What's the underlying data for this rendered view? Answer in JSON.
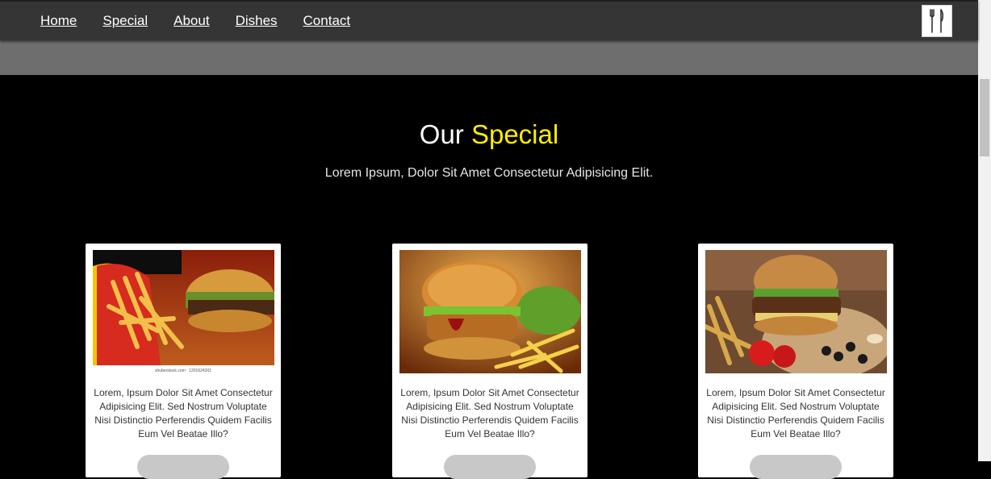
{
  "nav": {
    "items": [
      {
        "label": "Home"
      },
      {
        "label": "Special"
      },
      {
        "label": "About"
      },
      {
        "label": "Dishes"
      },
      {
        "label": "Contact"
      }
    ],
    "logo_icon": "fork-knife-icon"
  },
  "special": {
    "title_main": "Our",
    "title_accent": "Special",
    "accent_color": "#ffee00",
    "subtitle": "Lorem Ipsum, Dolor Sit Amet Consectetur Adipisicing Elit."
  },
  "cards": [
    {
      "image": "burger-and-fries-photo",
      "image_caption": "shutterstock.com · 1201624301",
      "text": "Lorem, Ipsum Dolor Sit Amet Consectetur Adipisicing Elit. Sed Nostrum Voluptate Nisi Distinctio Perferendis Quidem Facilis Eum Vel Beatae Illo?"
    },
    {
      "image": "chicken-burger-photo",
      "text": "Lorem, Ipsum Dolor Sit Amet Consectetur Adipisicing Elit. Sed Nostrum Voluptate Nisi Distinctio Perferendis Quidem Facilis Eum Vel Beatae Illo?"
    },
    {
      "image": "burger-plate-photo",
      "text": "Lorem, Ipsum Dolor Sit Amet Consectetur Adipisicing Elit. Sed Nostrum Voluptate Nisi Distinctio Perferendis Quidem Facilis Eum Vel Beatae Illo?"
    }
  ]
}
